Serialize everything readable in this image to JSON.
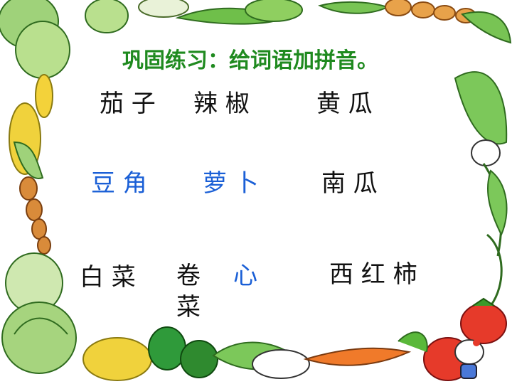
{
  "slide": {
    "title": "巩固练习：给词语加拼音。",
    "rows": [
      [
        "茄 子",
        "辣 椒",
        "黄 瓜"
      ],
      [
        "豆 角",
        "萝 卜",
        "南 瓜"
      ],
      [
        "白 菜",
        "卷",
        "心",
        "菜",
        "西 红 柿"
      ]
    ]
  },
  "colors": {
    "title_green": "#1f8a1f",
    "text_black": "#111111",
    "text_blue": "#1a5fd6"
  },
  "decorations": [
    "vegetable-border",
    "cabbage-icon",
    "corn-icon",
    "carrot-icon",
    "radish-icon",
    "tomato-icon",
    "pepper-icon",
    "hello-kitty-icon"
  ]
}
